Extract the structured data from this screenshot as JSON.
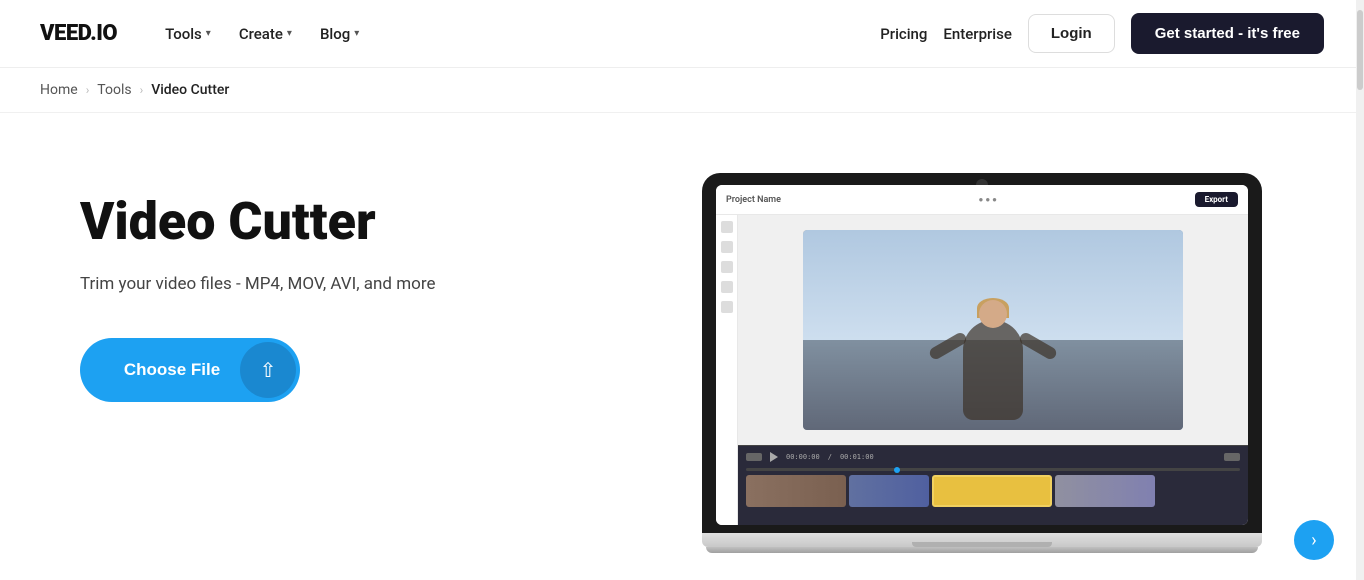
{
  "nav": {
    "logo": "VEED.IO",
    "items": [
      {
        "label": "Tools",
        "id": "tools"
      },
      {
        "label": "Create",
        "id": "create"
      },
      {
        "label": "Blog",
        "id": "blog"
      }
    ],
    "right_links": [
      {
        "label": "Pricing",
        "id": "pricing"
      },
      {
        "label": "Enterprise",
        "id": "enterprise"
      }
    ],
    "login_label": "Login",
    "cta_label": "Get started - it's free"
  },
  "breadcrumb": {
    "items": [
      {
        "label": "Home",
        "id": "home"
      },
      {
        "label": "Tools",
        "id": "tools"
      },
      {
        "label": "Video Cutter",
        "id": "video-cutter"
      }
    ]
  },
  "hero": {
    "title": "Video Cutter",
    "subtitle": "Trim your video files - MP4, MOV, AVI, and more",
    "choose_file_label": "Choose File"
  },
  "editor": {
    "project_name": "Project Name",
    "export_label": "Export",
    "time_current": "00:00:00",
    "time_total": "00:01:00"
  },
  "scrollbar": {
    "visible": true
  }
}
